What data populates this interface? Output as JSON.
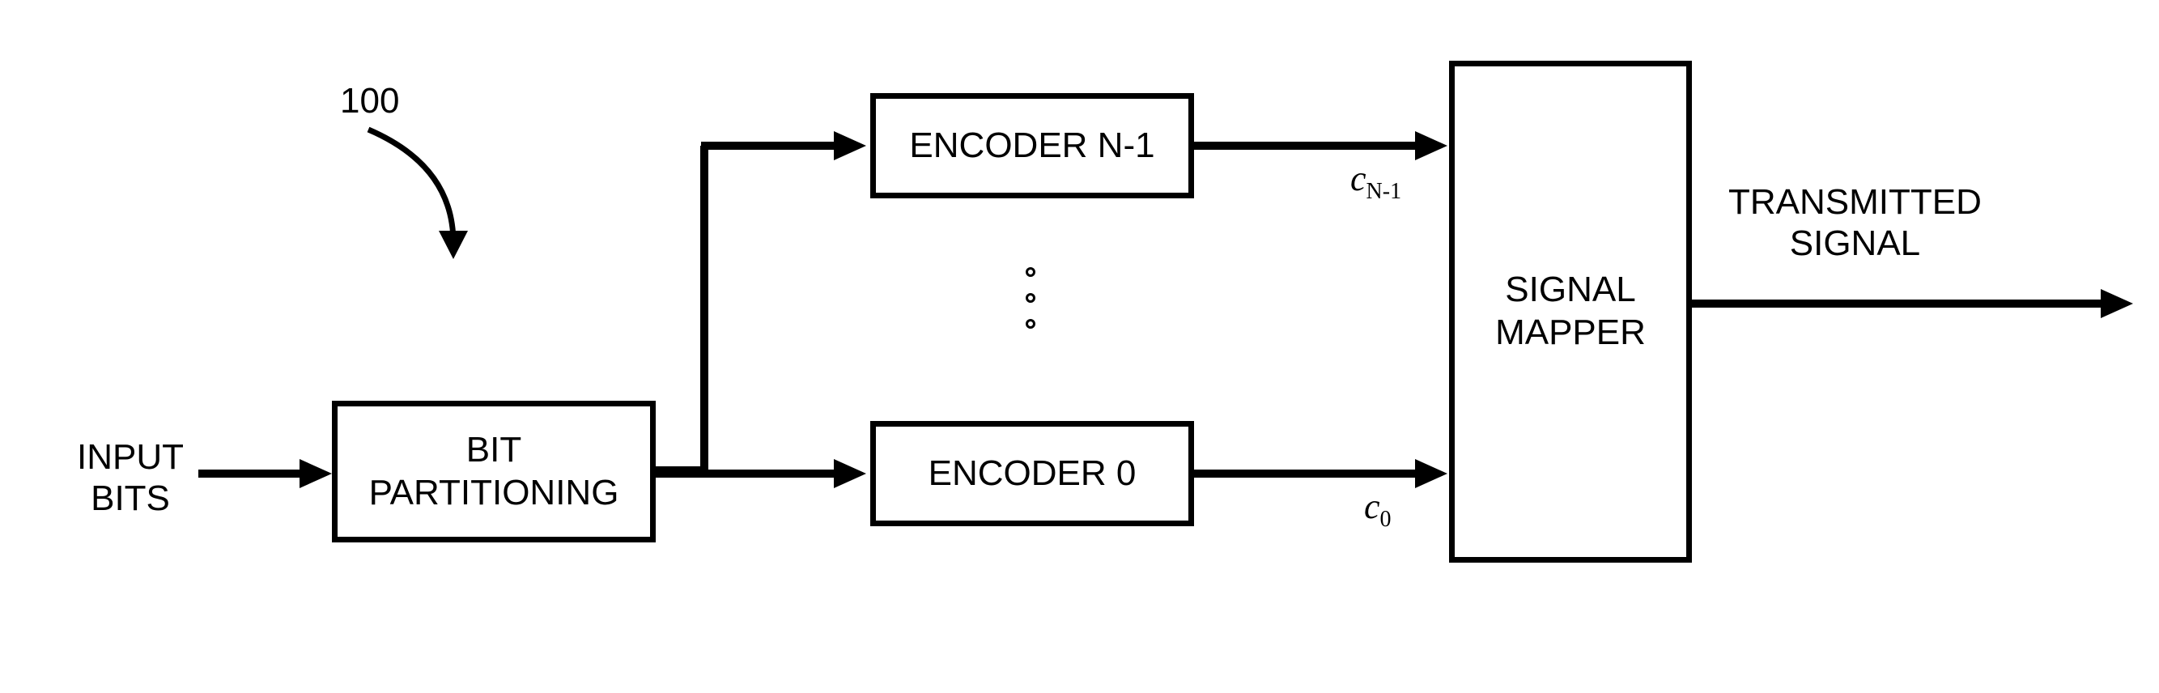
{
  "diagram_label": "100",
  "input_label": "INPUT\nBITS",
  "bit_partitioning": "BIT\nPARTITIONING",
  "encoder_top": "ENCODER N-1",
  "encoder_bottom": "ENCODER 0",
  "c_top": "c",
  "c_top_sub": "N-1",
  "c_bottom": "c",
  "c_bottom_sub": "0",
  "signal_mapper": "SIGNAL\nMAPPER",
  "output_label": "TRANSMITTED\nSIGNAL"
}
